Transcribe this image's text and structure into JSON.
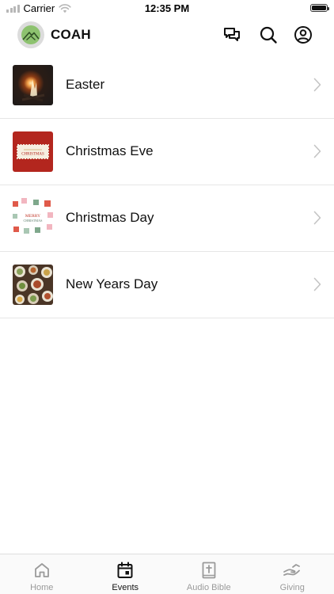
{
  "status_bar": {
    "carrier": "Carrier",
    "time": "12:35 PM"
  },
  "header": {
    "title": "COAH",
    "icons": [
      "chat-icon",
      "search-icon",
      "profile-icon"
    ]
  },
  "events": [
    {
      "label": "Easter",
      "thumbnail": "campfire-photo"
    },
    {
      "label": "Christmas Eve",
      "thumbnail": "christmas-red-card"
    },
    {
      "label": "Christmas Day",
      "thumbnail": "merry-christmas-card"
    },
    {
      "label": "New Years Day",
      "thumbnail": "food-table-photo"
    }
  ],
  "thumbnail_text": {
    "christmas_eve": "CHRISTMAS",
    "christmas_day_line1": "MERRY",
    "christmas_day_line2": "CHRISTMAS"
  },
  "tab_bar": {
    "tabs": [
      {
        "label": "Home",
        "icon": "home-icon",
        "active": false
      },
      {
        "label": "Events",
        "icon": "calendar-icon",
        "active": true
      },
      {
        "label": "Audio Bible",
        "icon": "bible-icon",
        "active": false
      },
      {
        "label": "Giving",
        "icon": "giving-hand-icon",
        "active": false
      }
    ]
  },
  "colors": {
    "logo_green": "#8dc26f",
    "active_tab": "#111111",
    "inactive_tab": "#9a9a9a",
    "christmas_red": "#b3261e"
  }
}
